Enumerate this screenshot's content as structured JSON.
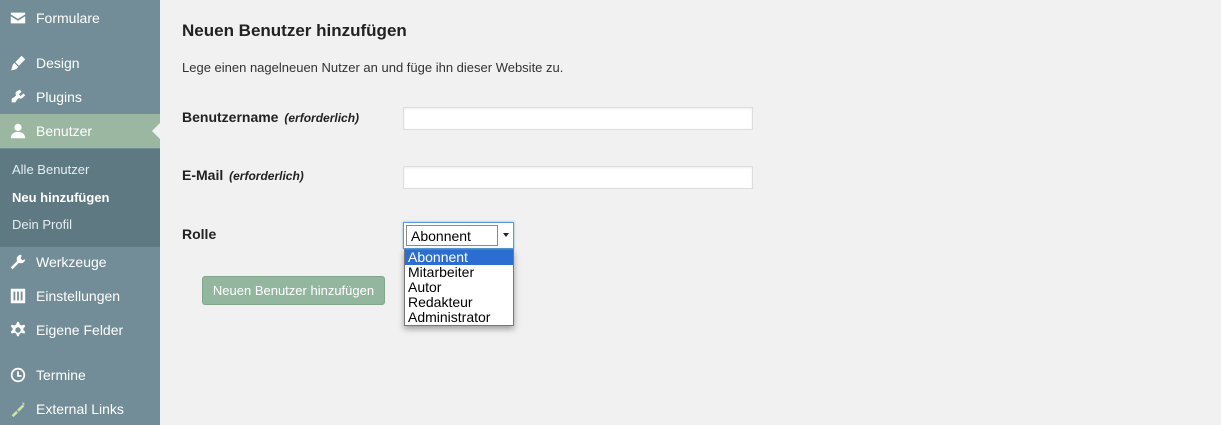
{
  "sidebar": {
    "items": [
      {
        "label": "Formulare",
        "icon": "mail-icon"
      },
      {
        "label": "Design",
        "icon": "brush-icon"
      },
      {
        "label": "Plugins",
        "icon": "plugin-icon"
      },
      {
        "label": "Benutzer",
        "icon": "user-icon",
        "active": true
      },
      {
        "label": "Werkzeuge",
        "icon": "wrench-icon"
      },
      {
        "label": "Einstellungen",
        "icon": "sliders-icon"
      },
      {
        "label": "Eigene Felder",
        "icon": "gear-icon"
      },
      {
        "label": "Termine",
        "icon": "clock-icon"
      },
      {
        "label": "External Links",
        "icon": "link-icon"
      }
    ],
    "submenu": [
      {
        "label": "Alle Benutzer"
      },
      {
        "label": "Neu hinzufügen",
        "current": true
      },
      {
        "label": "Dein Profil"
      }
    ]
  },
  "main": {
    "title": "Neuen Benutzer hinzufügen",
    "description": "Lege einen nagelneuen Nutzer an und füge ihn dieser Website zu.",
    "fields": {
      "username": {
        "label": "Benutzername",
        "required": "(erforderlich)",
        "value": ""
      },
      "email": {
        "label": "E-Mail",
        "required": "(erforderlich)",
        "value": ""
      },
      "role": {
        "label": "Rolle",
        "selected": "Abonnent"
      }
    },
    "role_options": [
      "Abonnent",
      "Mitarbeiter",
      "Autor",
      "Redakteur",
      "Administrator"
    ],
    "submit_label": "Neuen Benutzer hinzufügen"
  },
  "colors": {
    "sidebar_bg": "#728d97",
    "submenu_bg": "#5f7983",
    "active_bg": "#9bb7a1",
    "button_bg": "#93b69e",
    "selected_option_bg": "#2b6dd1"
  }
}
